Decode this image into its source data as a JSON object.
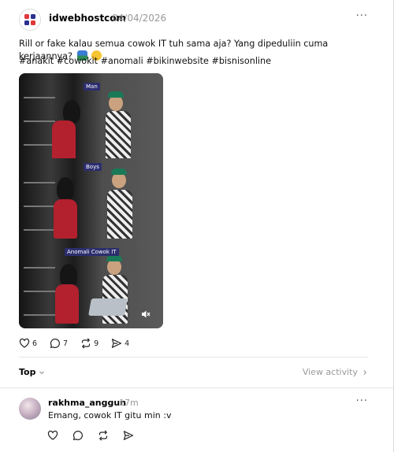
{
  "post": {
    "author": "idwebhostcom",
    "date": "04/04/2026",
    "more": "···",
    "caption": "Rill or fake kalau semua cowok IT tuh sama aja? Yang dipeduliin cuma kerjaannya?",
    "hashtags": "#anakit #cowokit #anomali #bikinwebsite #bisnisonline",
    "media_labels": [
      "Man",
      "Boys",
      "Anomali Cowok IT"
    ],
    "stats": {
      "likes": "6",
      "comments": "7",
      "reposts": "9",
      "shares": "4"
    }
  },
  "thread_bar": {
    "sort_label": "Top",
    "view_activity": "View activity"
  },
  "reply": {
    "user": "rakhma_anggun",
    "time": "17m",
    "more": "···",
    "text": "Emang, cowok IT gitu min :v"
  },
  "colors": {
    "accent": "#2c2e6e",
    "muted": "#999999",
    "brand_red": "#e0373b",
    "brand_blue": "#2b2f8f"
  }
}
